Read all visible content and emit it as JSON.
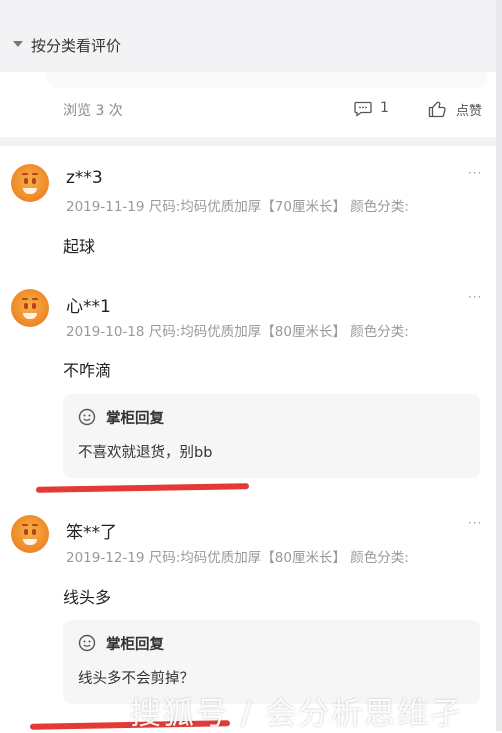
{
  "header": {
    "title": "按分类看评价"
  },
  "stats": {
    "views_label": "浏览 3 次",
    "comment_count": "1",
    "like_label": "点赞"
  },
  "reviews": [
    {
      "username": "z**3",
      "meta": "2019-11-19 尺码:均码优质加厚【70厘米长】 颜色分类:",
      "text": "起球"
    },
    {
      "username": "心**1",
      "meta": "2019-10-18 尺码:均码优质加厚【80厘米长】 颜色分类:",
      "text": "不咋滴",
      "reply": {
        "title": "掌柜回复",
        "text": "不喜欢就退货，别bb"
      }
    },
    {
      "username": "笨**了",
      "meta": "2019-12-19 尺码:均码优质加厚【80厘米长】 颜色分类:",
      "text": "线头多",
      "reply": {
        "title": "掌柜回复",
        "text": "线头多不会剪掉？"
      }
    }
  ],
  "more_icon": "···",
  "watermark": "搜狐号 / 会分析思维孑",
  "colors": {
    "highlight": "#e23a36",
    "background": "#ffffff",
    "muted": "#999999"
  }
}
